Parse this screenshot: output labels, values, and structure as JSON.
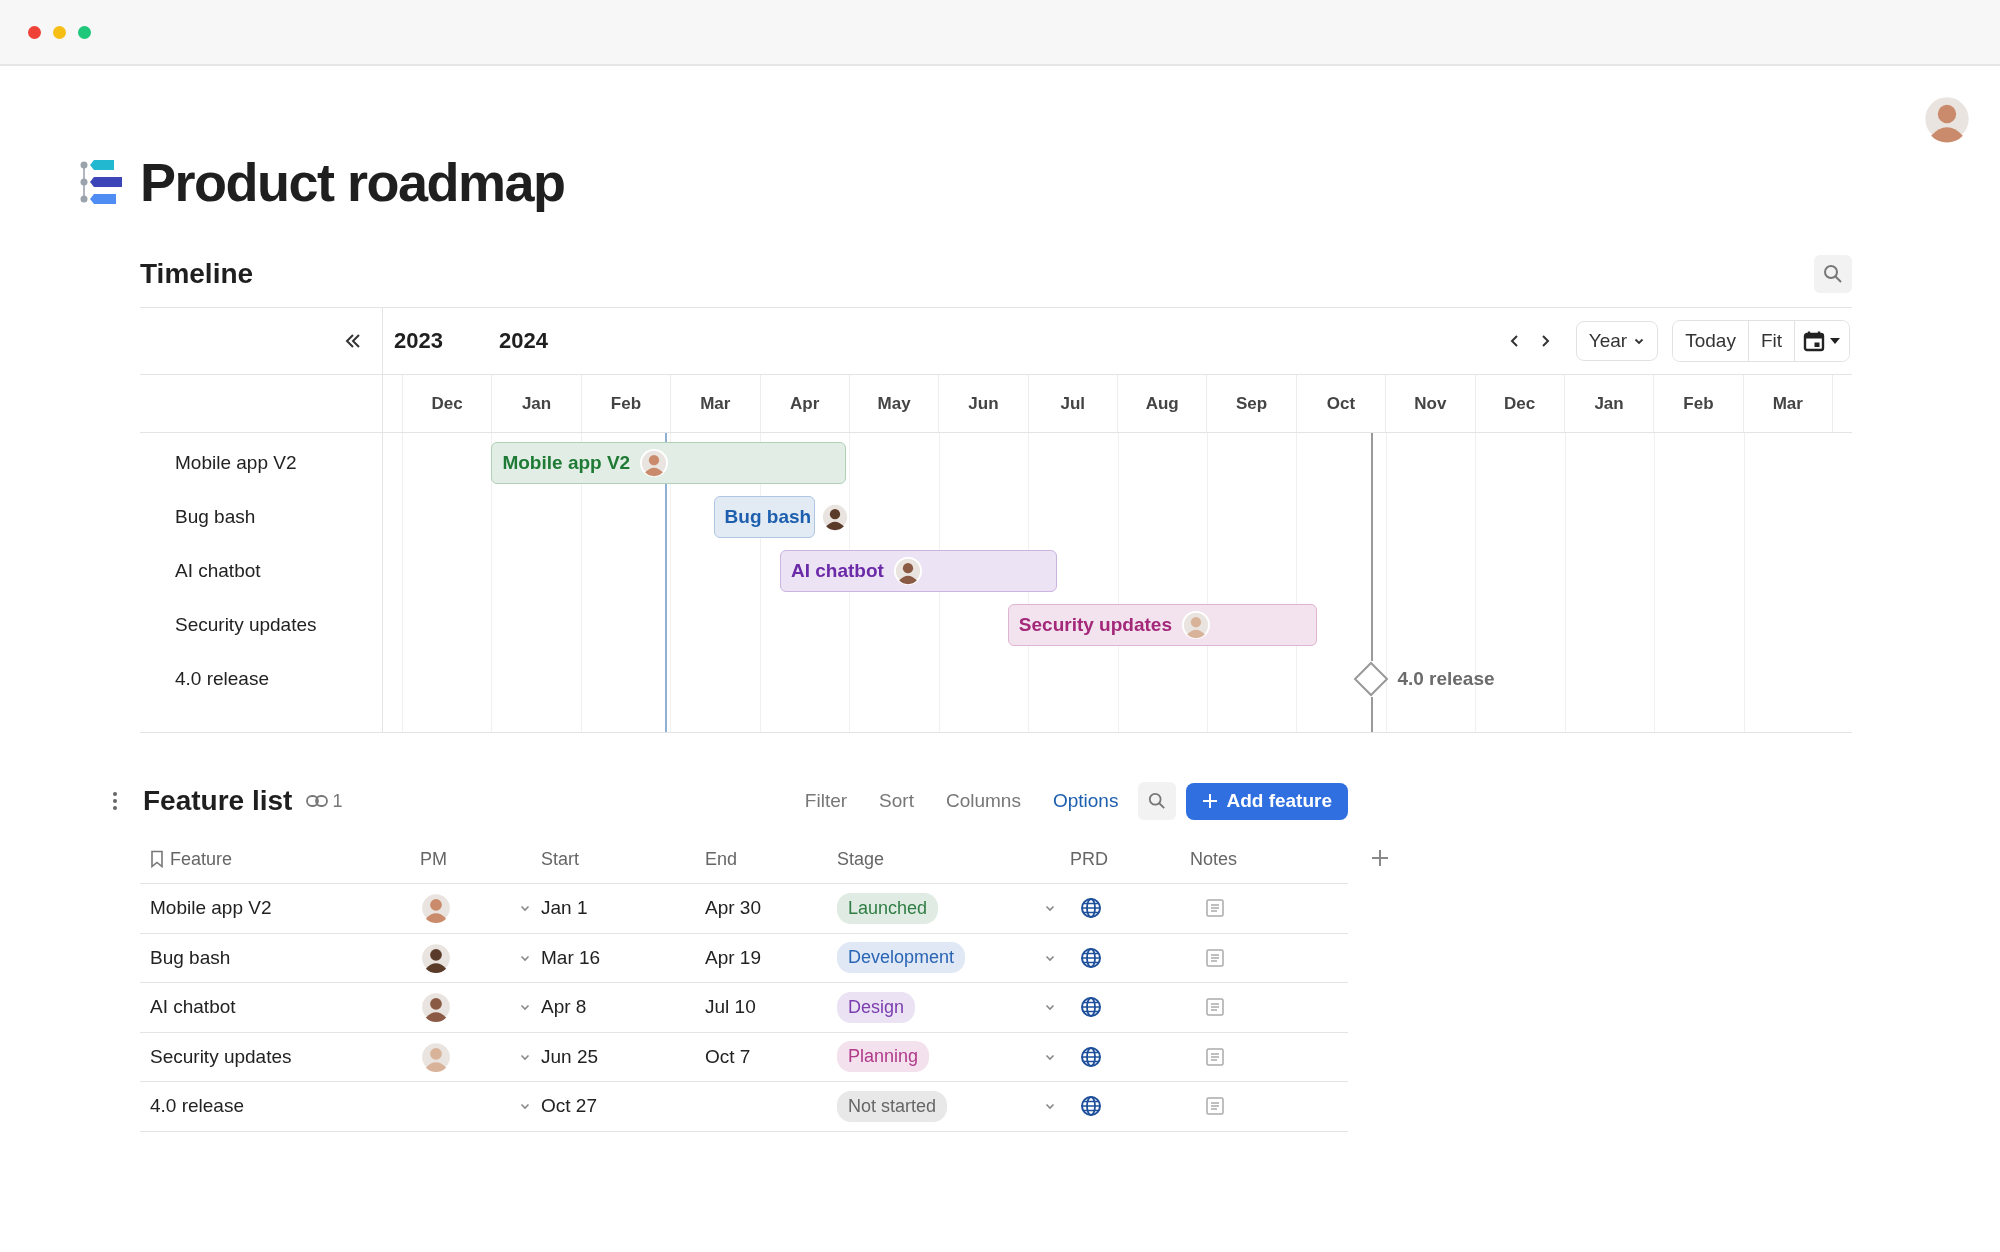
{
  "page": {
    "title": "Product roadmap"
  },
  "timeline": {
    "title": "Timeline",
    "years": [
      "2023",
      "2024"
    ],
    "view": "Year",
    "buttons": [
      "Today",
      "Fit"
    ],
    "months": [
      "Dec",
      "Jan",
      "Feb",
      "Mar",
      "Apr",
      "May",
      "Jun",
      "Jul",
      "Aug",
      "Sep",
      "Oct",
      "Nov",
      "Dec",
      "Jan",
      "Feb",
      "Mar"
    ],
    "rows": [
      {
        "name": "Mobile app V2",
        "kind": "bar",
        "bar_label": "Mobile app V2",
        "color": "#1e7a35"
      },
      {
        "name": "Bug bash",
        "kind": "bar",
        "bar_label": "Bug bash",
        "color": "#1d5fae"
      },
      {
        "name": "AI chatbot",
        "kind": "bar",
        "bar_label": "AI chatbot",
        "color": "#6b2aa8"
      },
      {
        "name": "Security updates",
        "kind": "bar",
        "bar_label": "Security updates",
        "color": "#a3287a"
      },
      {
        "name": "4.0 release",
        "kind": "milestone",
        "bar_label": "4.0 release",
        "color": "#6b6b6b"
      }
    ]
  },
  "feature_list": {
    "title": "Feature list",
    "link_count": "1",
    "toolbar": [
      {
        "label": "Filter",
        "selected": false
      },
      {
        "label": "Sort",
        "selected": false
      },
      {
        "label": "Columns",
        "selected": false
      },
      {
        "label": "Options",
        "selected": true
      }
    ],
    "add_button": "Add feature",
    "columns": [
      "Feature",
      "PM",
      "Start",
      "End",
      "Stage",
      "PRD",
      "Notes"
    ],
    "rows": [
      {
        "feature": "Mobile app V2",
        "pm_avatar": true,
        "start": "Jan 1",
        "end": "Apr 30",
        "stage": {
          "label": "Launched",
          "color": "#2f7d43"
        }
      },
      {
        "feature": "Bug bash",
        "pm_avatar": true,
        "start": "Mar 16",
        "end": "Apr 19",
        "stage": {
          "label": "Development",
          "color": "#2a64b5"
        }
      },
      {
        "feature": "AI chatbot",
        "pm_avatar": true,
        "start": "Apr 8",
        "end": "Jul 10",
        "stage": {
          "label": "Design",
          "color": "#7b3db0"
        }
      },
      {
        "feature": "Security updates",
        "pm_avatar": true,
        "start": "Jun 25",
        "end": "Oct 7",
        "stage": {
          "label": "Planning",
          "color": "#b03a8a"
        }
      },
      {
        "feature": "4.0 release",
        "pm_avatar": false,
        "start": "Oct 27",
        "end": "",
        "stage": {
          "label": "Not started",
          "color": "#666666"
        }
      }
    ]
  }
}
